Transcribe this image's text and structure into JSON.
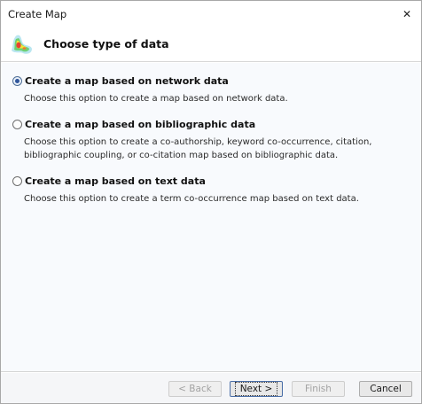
{
  "window": {
    "title": "Create Map",
    "close_label": "✕"
  },
  "header": {
    "title": "Choose type of data",
    "icon": "vosviewer-density-map-icon"
  },
  "options": [
    {
      "label": "Create a map based on network data",
      "description": "Choose this option to create a map based on network data.",
      "checked": true
    },
    {
      "label": "Create a map based on bibliographic data",
      "description": "Choose this option to create a co-authorship, keyword co-occurrence, citation, bibliographic coupling, or co-citation map based on bibliographic data.",
      "checked": false
    },
    {
      "label": "Create a map based on text data",
      "description": "Choose this option to create a term co-occurrence map based on text data.",
      "checked": false
    }
  ],
  "buttons": {
    "back": "< Back",
    "next": "Next >",
    "finish": "Finish",
    "cancel": "Cancel"
  }
}
